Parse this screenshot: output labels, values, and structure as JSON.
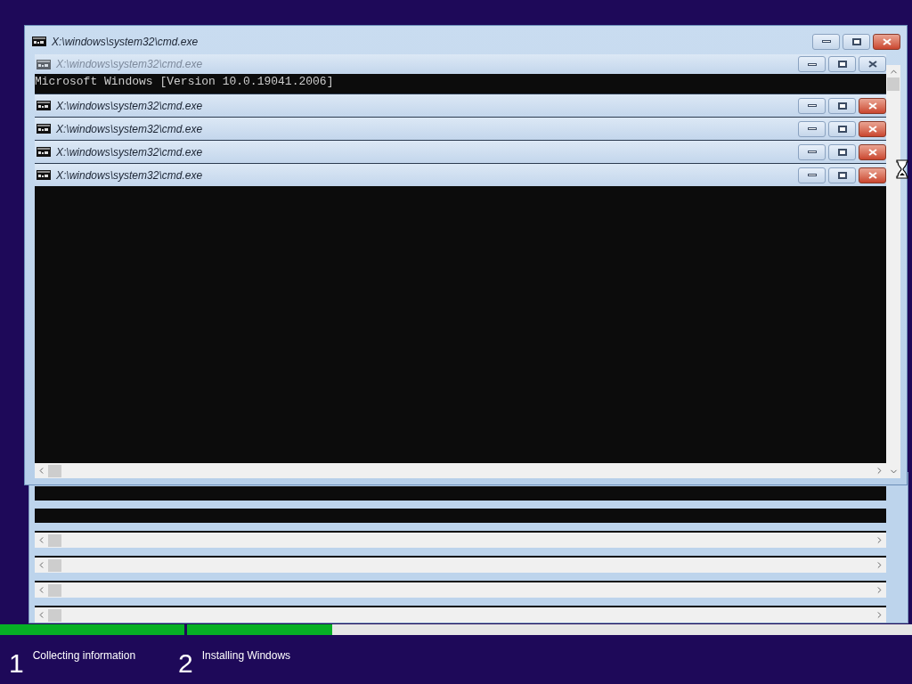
{
  "front_window": {
    "title": "X:\\windows\\system32\\cmd.exe",
    "active": true
  },
  "stacked_windows": [
    {
      "title": "X:\\windows\\system32\\cmd.exe",
      "active": false
    },
    {
      "title": "X:\\windows\\system32\\cmd.exe",
      "active": true
    },
    {
      "title": "X:\\windows\\system32\\cmd.exe",
      "active": true
    },
    {
      "title": "X:\\windows\\system32\\cmd.exe",
      "active": true
    },
    {
      "title": "X:\\windows\\system32\\cmd.exe",
      "active": true
    }
  ],
  "console": {
    "lines": [
      "Microsoft Windows [Version 10.0.19041.2006]"
    ]
  },
  "progress": [
    {
      "level": 1
    },
    {
      "level": 0.2
    }
  ],
  "steps": [
    {
      "number": "1",
      "label": "Collecting information"
    },
    {
      "number": "2",
      "label": "Installing Windows"
    }
  ]
}
